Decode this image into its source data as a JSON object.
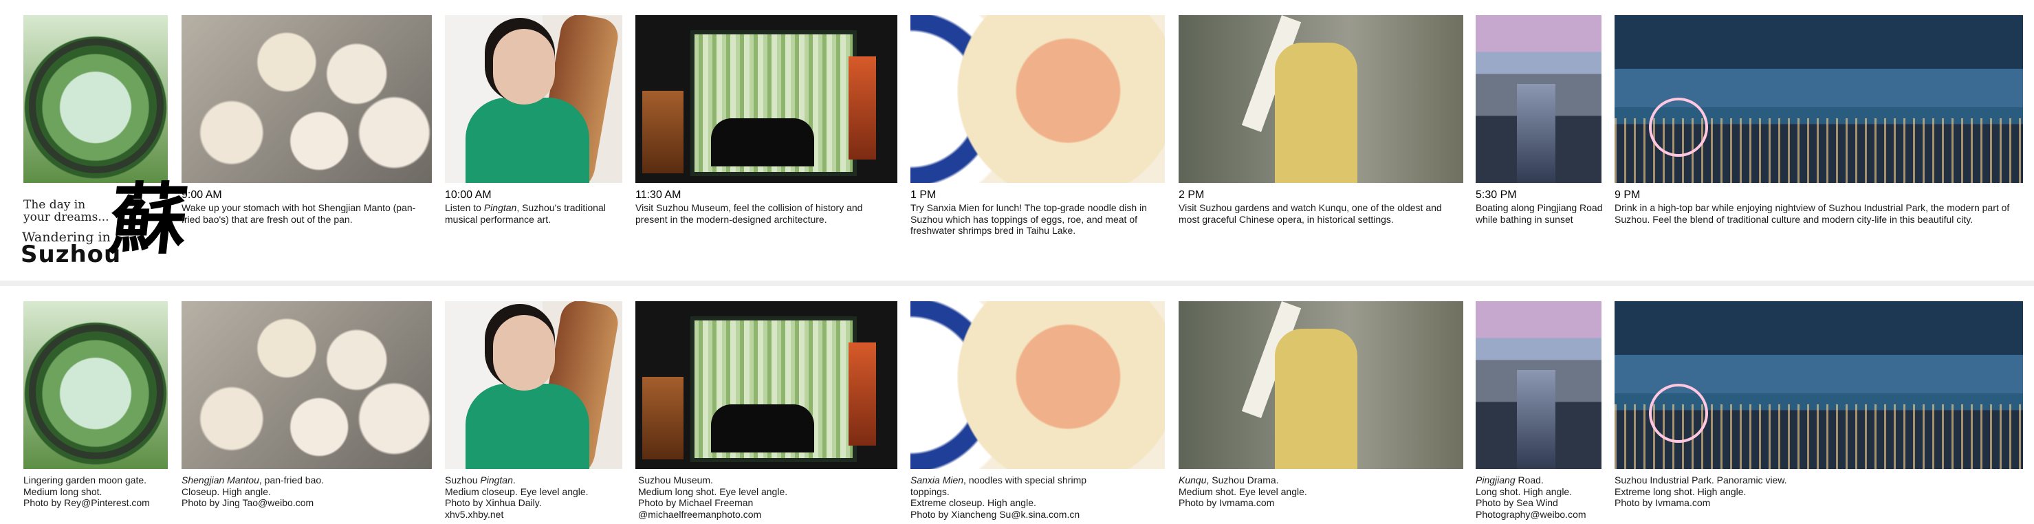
{
  "logo": {
    "line1": "The day in",
    "line2": "your dreams...",
    "line3": "Wandering in",
    "line4": "Suzhou",
    "glyph": "蘇"
  },
  "schedule": [
    {
      "time": "9:00 AM",
      "text": "Wake up your stomach with hot Shengjian Manto (pan-fried bao's) that are fresh out of the pan."
    },
    {
      "time": "10:00 AM",
      "text_pre": "Listen to ",
      "text_it": "Pingtan",
      "text_post": ", Suzhou's traditional musical performance art."
    },
    {
      "time": "11:30 AM",
      "text": "Visit Suzhou Museum, feel the collision of history and present in the modern-designed architecture."
    },
    {
      "time": "1 PM",
      "text": "Try Sanxia Mien for lunch! The top-grade noodle dish in Suzhou which has toppings of eggs, roe, and meat of freshwater shrimps bred in Taihu Lake."
    },
    {
      "time": "2 PM",
      "text": "Visit Suzhou gardens and watch Kunqu, one of the oldest and most graceful Chinese opera, in historical settings."
    },
    {
      "time": "5:30 PM",
      "text": "Boating along Pingjiang Road while bathing in  sunset"
    },
    {
      "time": "9 PM",
      "text": "Drink in a high-top bar while enjoying nightview of Suzhou Industrial Park, the modern part of Suzhou. Feel the blend of traditional culture and modern city-life in this beautiful city."
    }
  ],
  "credits": [
    {
      "l1": "Lingering garden moon gate.",
      "l2": "Medium long shot.",
      "l3": "Photo by Rey@Pinterest.com"
    },
    {
      "l1_it": "Shengjian Mantou",
      "l1_post": ", pan-fried bao.",
      "l2": "Closeup. High angle.",
      "l3": "Photo by Jing Tao@weibo.com"
    },
    {
      "l1_pre": "Suzhou ",
      "l1_it": "Pingtan",
      "l1_post": ".",
      "l2": "Medium closeup. Eye level angle.",
      "l3": "Photo by Xinhua Daily.",
      "l4": "xhv5.xhby.net"
    },
    {
      "l1": "Suzhou Museum.",
      "l2": "Medium long shot. Eye level angle.",
      "l3": "Photo by Michael Freeman",
      "l4": "@michaelfreemanphoto.com"
    },
    {
      "l1_it": "Sanxia Mien",
      "l1_post": ", noodles with special shrimp",
      "l1b": "toppings.",
      "l2": "Extreme closeup. High angle.",
      "l3": "Photo by Xiancheng Su@k.sina.com.cn"
    },
    {
      "l1_it": "Kunqu",
      "l1_post": ", Suzhou Drama.",
      "l2": "Medium shot. Eye level angle.",
      "l3": "Photo by Ivmama.com"
    },
    {
      "l1_it": "Pingjiang",
      "l1_post": " Road.",
      "l2": "Long shot. High angle.",
      "l3": "Photo by Sea Wind",
      "l4": "Photography@weibo.com"
    },
    {
      "l1": "Suzhou Industrial Park. Panoramic view.",
      "l2": "Extreme long shot. High angle.",
      "l3": "Photo by Ivmama.com"
    }
  ]
}
